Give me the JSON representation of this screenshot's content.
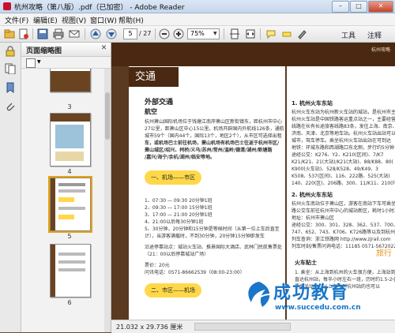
{
  "window": {
    "title": "杭州攻略（第八版）.pdf（已加密） - Adobe Reader",
    "minimize": "–",
    "maximize": "□",
    "close": "✕"
  },
  "menu": [
    "文件(F)",
    "编辑(E)",
    "视图(V)",
    "窗口(W)",
    "帮助(H)"
  ],
  "toolbar": {
    "page_current": "5",
    "page_total": "/ 27",
    "zoom": "75%",
    "tools_label": "工具",
    "comment_label": "注释"
  },
  "panel": {
    "title": "页面缩略图",
    "close": "✕",
    "thumb_labels": [
      "3",
      "4",
      "5",
      "6"
    ]
  },
  "status": {
    "page_size": "21.032 x 29.736 厘米"
  },
  "doc": {
    "band_note": "杭州攻略",
    "section_title": "交通",
    "left": {
      "heading": "外部交通",
      "sub": "航空",
      "para": [
        "杭州萧山国际机场位于钱塘江南岸萧山区新街镇东，距杭州市中心",
        "27公里，距萧山区中心15公里。机场开辟国内外航线126条，通航",
        "城市59个（国内44个，国际13个，地区2个），从市区可选择出租",
        "车，或机场巴士前往机场，萧山机场有机场巴士往返于杭州市区/",
        "萧山城区/绍兴、柯桥/义乌/苏州/常州/温岭/德清/湖州/新塘路",
        "/嘉兴/海宁/余杭/湖州/临安等地。"
      ],
      "pill1": "一、机场——市区",
      "lines": [
        "1、07:30 — 09:30  20分钟1班",
        "2、09:30 — 17:00  15分钟1班",
        "3、17:00 — 21:00  20分钟1班",
        "4、21:00以后每30分钟1班",
        "5、30分钟，20分钟和15分钟是等候时间（从第一位上车后直至",
        "   计），当游客满载时，不到30分钟，20分钟15分钟即发车"
      ],
      "route": [
        "沿途停靠站点：城站火车站、推景国际大酒店、武林门民航售票处",
        "（21：00以后停靠城站广场）"
      ],
      "fare": "票价：20元",
      "phone": "问讯电话：0571-86662539（08:00-23:00）",
      "pill2": "二、市区——机场"
    },
    "right": {
      "h1": "1. 杭州火车东站",
      "p1": [
        "杭州火车东站为杭州新火车站的城站，是杭州市主要",
        "杭州火车站是中国铁路客运重点站之一，主要经营",
        "线路在长有长途旅客线路83条，发往上海、南京、",
        "济南、天津、北京等地车站。杭州火车站出站可以到达",
        "城市，驾车停车。乘坐杭州火车站出站在可到达",
        "地铁：环城东路和西湖路口东北侧，步行约5分钟",
        "途经公交：K276、Y2、K210(区间)、7/K7",
        "K21/K21、21(大站)/K21(大站)、88/K88、80(",
        "K900(火车站)、528/K528、49/K49、3",
        "K508、537(区间)、116、222路、525(大站)",
        "140、220(区)、206路、300、11/K11、210(环线)"
      ],
      "h2": "2. 杭州火车东站",
      "p2": [
        "杭州火车南站位于萧山区，游客在南站下车可乘坐",
        "路公交车前往杭州市中心的城站新区，耗时1小时左右",
        "地址：杭州市萧山区",
        "途经公交：300、301、328、362、537、700、",
        "747、652、743、K706、K726路等以及到杭州",
        "列车查询：浙江铁路网 http://www.zjrail.com",
        "列车时刻/售票问询电话：11185 0571-56720222"
      ],
      "accent": "旅行",
      "h3": "火车贴士",
      "p3": [
        "1.  乘坐：从上海到杭州的火车很方便，上海站到",
        "    直达杭州站，每半小时左右一班，历时约1.5-2小时",
        "    要乘坐动车，从上海站到杭州站的也可以"
      ]
    },
    "watermark": {
      "brand": "成功教育",
      "url": "www.succedu.com.cn"
    }
  },
  "colors": {
    "brown": "#4a2812",
    "yellow": "#ffd84a",
    "accent": "#e8961e",
    "brand_blue": "#1976c8"
  }
}
